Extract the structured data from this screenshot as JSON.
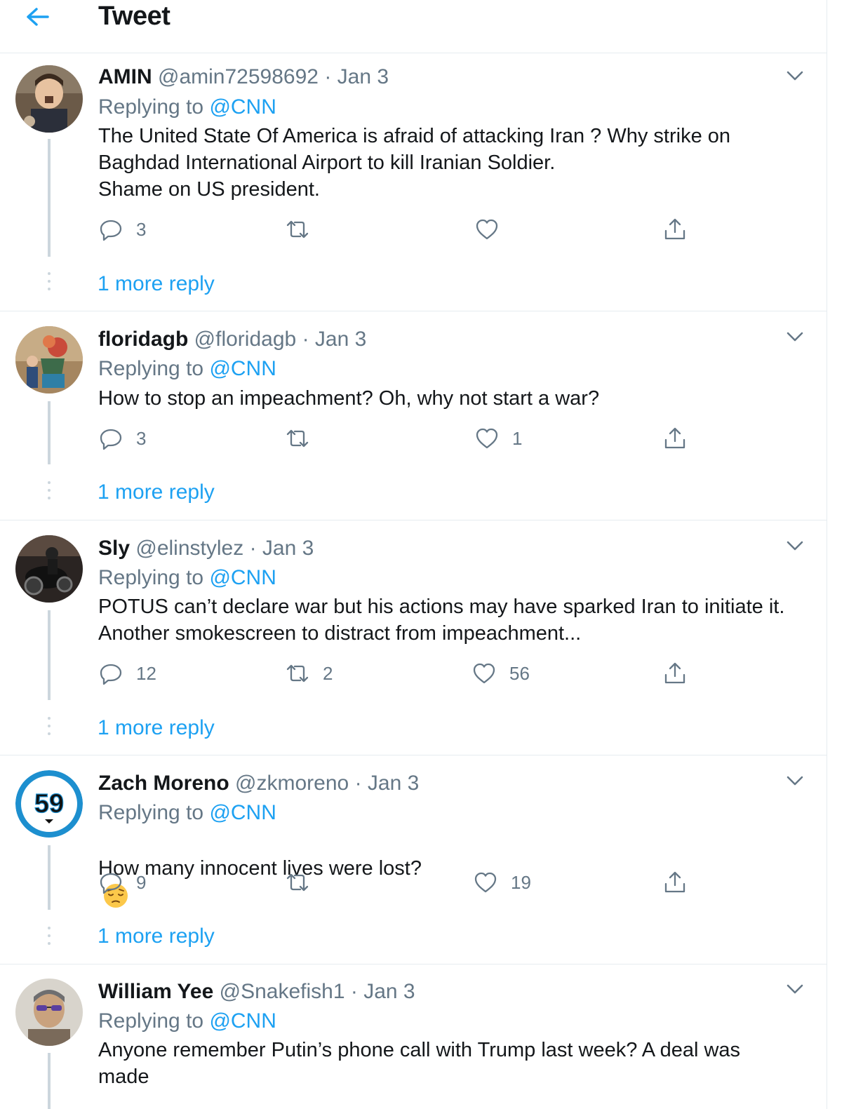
{
  "header": {
    "title": "Tweet"
  },
  "tweets": [
    {
      "name": "AMIN",
      "handle": "@amin72598692",
      "sep": "·",
      "date": "Jan 3",
      "replying_prefix": "Replying to ",
      "replying_to": "@CNN",
      "text": "The United State Of America is afraid of attacking Iran ? Why strike on Baghdad International Airport to kill Iranian Soldier.\nShame on US president.",
      "replies": "3",
      "retweets": "",
      "likes": "",
      "more_replies": "1 more reply"
    },
    {
      "name": "floridagb",
      "handle": "@floridagb",
      "sep": "·",
      "date": "Jan 3",
      "replying_prefix": "Replying to ",
      "replying_to": "@CNN",
      "text": "How to stop an impeachment? Oh, why not start a war?",
      "replies": "3",
      "retweets": "",
      "likes": "1",
      "more_replies": "1 more reply"
    },
    {
      "name": "Sly",
      "handle": "@elinstylez",
      "sep": "·",
      "date": "Jan 3",
      "replying_prefix": "Replying to ",
      "replying_to": "@CNN",
      "text": "POTUS can’t declare war but his actions may have sparked Iran to initiate it. Another smokescreen to distract from impeachment...",
      "replies": "12",
      "retweets": "2",
      "likes": "56",
      "more_replies": "1 more reply"
    },
    {
      "name": "Zach Moreno",
      "handle": "@zkmoreno",
      "sep": "·",
      "date": "Jan 3",
      "replying_prefix": "Replying to ",
      "replying_to": "@CNN",
      "text": "How many innocent lives were lost?",
      "avatar_text": "59",
      "replies": "9",
      "retweets": "",
      "likes": "19",
      "more_replies": "1 more reply"
    },
    {
      "name": "William Yee",
      "handle": "@Snakefish1",
      "sep": "·",
      "date": "Jan 3",
      "replying_prefix": "Replying to ",
      "replying_to": "@CNN",
      "text": "Anyone remember Putin’s phone call with Trump last week? A deal was made"
    }
  ],
  "colors": {
    "accent": "#1da1f2",
    "muted": "#657786",
    "text": "#14171a",
    "border": "#e6ecf0"
  },
  "icons": {
    "back": "arrow-left-icon",
    "reply": "reply-icon",
    "retweet": "retweet-icon",
    "like": "heart-icon",
    "share": "share-icon",
    "menu": "chevron-down-icon",
    "emoji": "pensive-face-emoji"
  }
}
